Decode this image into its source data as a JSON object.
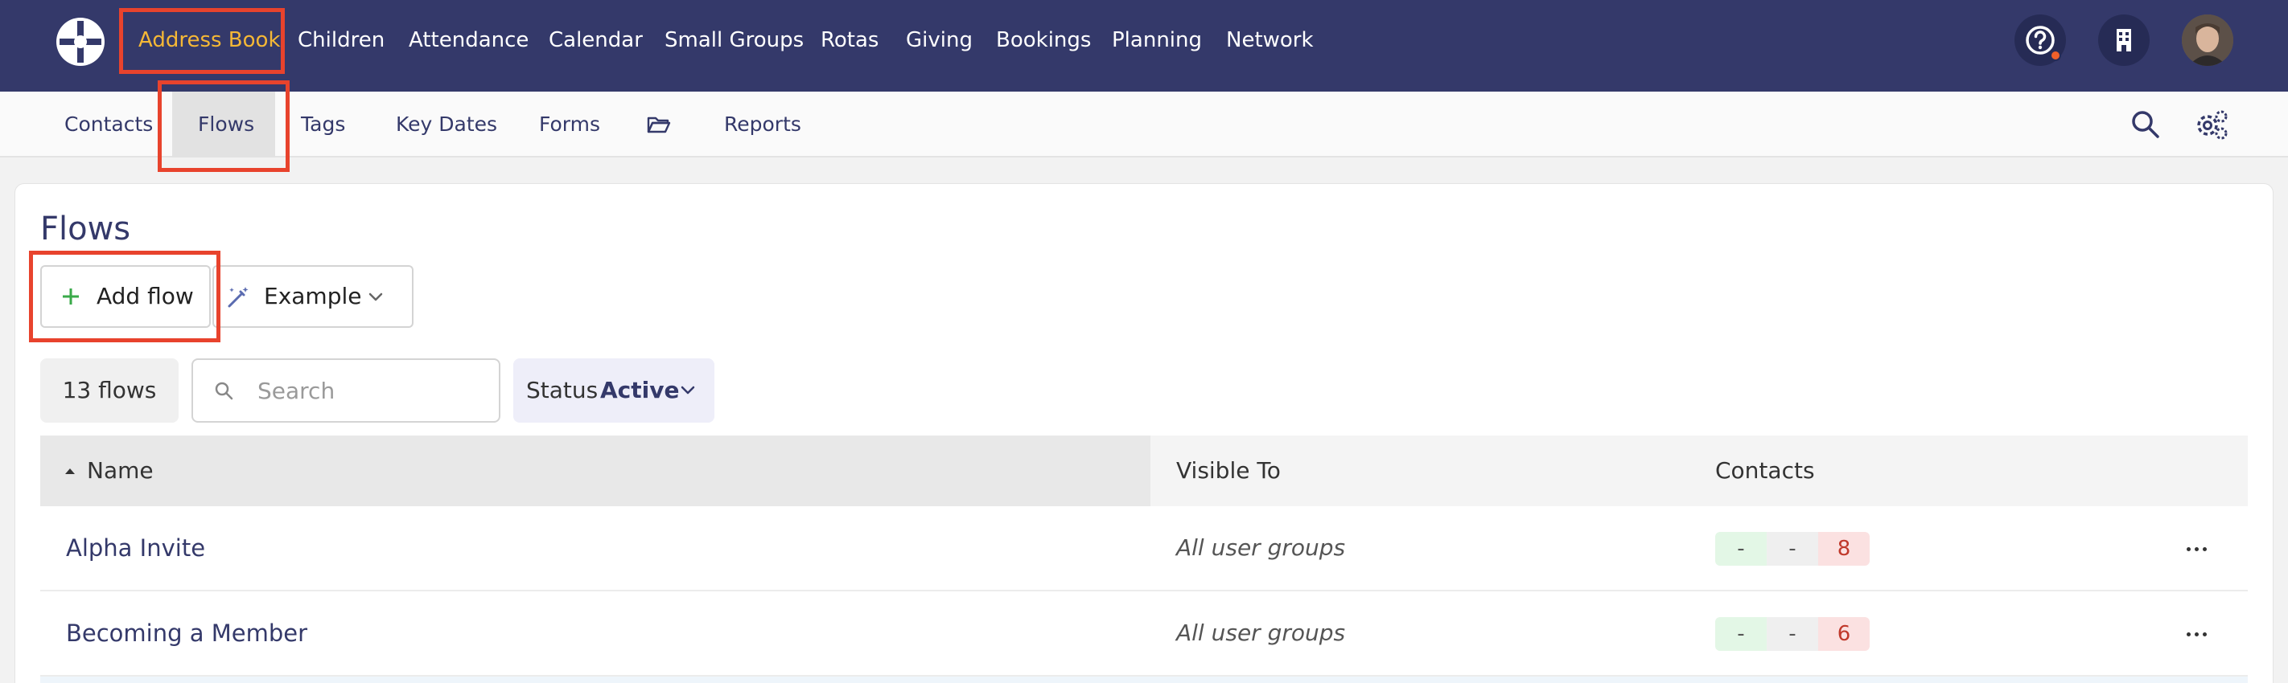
{
  "topnav": {
    "items": [
      {
        "label": "Address Book",
        "active": true
      },
      {
        "label": "Children"
      },
      {
        "label": "Attendance"
      },
      {
        "label": "Calendar"
      },
      {
        "label": "Small Groups"
      },
      {
        "label": "Rotas"
      },
      {
        "label": "Giving"
      },
      {
        "label": "Bookings"
      },
      {
        "label": "Planning"
      },
      {
        "label": "Network"
      }
    ],
    "icons": [
      "logo-icon",
      "help-icon",
      "building-icon",
      "avatar"
    ]
  },
  "subnav": {
    "items": [
      {
        "label": "Contacts"
      },
      {
        "label": "Flows",
        "active": true
      },
      {
        "label": "Tags"
      },
      {
        "label": "Key Dates"
      },
      {
        "label": "Forms"
      },
      {
        "label": "Reports",
        "icon": "folder-icon"
      }
    ],
    "icons": [
      "search-icon",
      "settings-icon"
    ]
  },
  "page": {
    "title": "Flows",
    "add_button": "Add flow",
    "example_button": "Example",
    "count": "13 flows",
    "search_placeholder": "Search",
    "status_label": "Status",
    "status_value": "Active"
  },
  "table": {
    "headers": {
      "name": "Name",
      "visible": "Visible To",
      "contacts": "Contacts"
    },
    "rows": [
      {
        "name": "Alpha Invite",
        "visible": "All user groups",
        "c1": "-",
        "c2": "-",
        "c3": "8"
      },
      {
        "name": "Becoming a Member",
        "visible": "All user groups",
        "c1": "-",
        "c2": "-",
        "c3": "6"
      }
    ]
  },
  "colors": {
    "nav_bg": "#34396a",
    "active_nav": "#f5b836",
    "annotation": "#e8432d",
    "link": "#34396a"
  }
}
